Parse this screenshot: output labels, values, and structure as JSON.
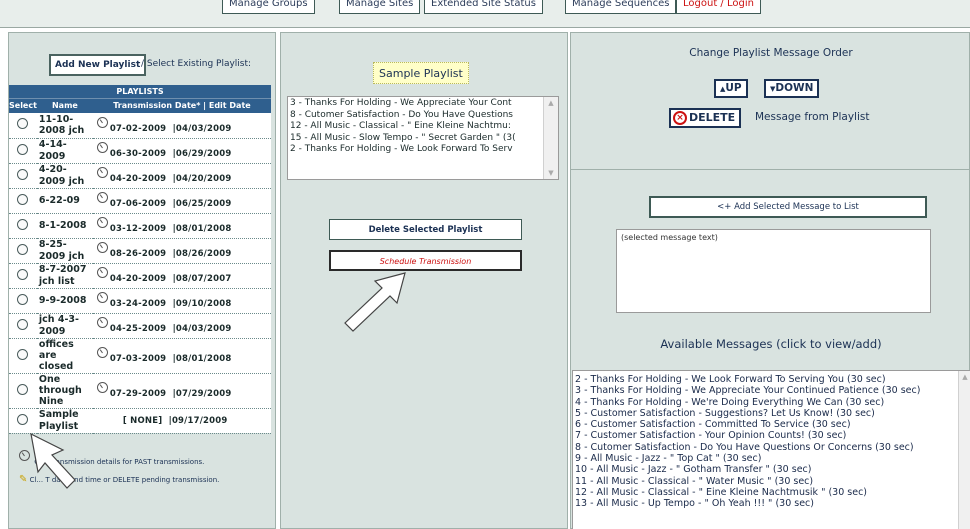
{
  "top_nav": {
    "manage_groups": "Manage Groups",
    "manage_sites": "Manage Sites",
    "extended_site_status": "Extended Site Status",
    "manage_sequences": "Manage Sequences",
    "logout_login": "Logout / Login"
  },
  "left": {
    "add_new_playlist": "Add New Playlist",
    "select_existing": "/ Select Existing Playlist:",
    "table_title": "PLAYLISTS",
    "columns": {
      "select": "Select",
      "name": "Name",
      "dates": "Transmission Date* | Edit Date"
    },
    "rows": [
      {
        "name": "11-10-2008 jch",
        "tx": "07-02-2009",
        "edit": "04/03/2009"
      },
      {
        "name": "4-14-2009",
        "tx": "06-30-2009",
        "edit": "06/29/2009"
      },
      {
        "name": "4-20-2009 jch",
        "tx": "04-20-2009",
        "edit": "04/20/2009"
      },
      {
        "name": "6-22-09",
        "tx": "07-06-2009",
        "edit": "06/25/2009"
      },
      {
        "name": "8-1-2008",
        "tx": "03-12-2009",
        "edit": "08/01/2008"
      },
      {
        "name": "8-25-2009 jch",
        "tx": "08-26-2009",
        "edit": "08/26/2009"
      },
      {
        "name": "8-7-2007 jch list",
        "tx": "04-20-2009",
        "edit": "08/07/2007"
      },
      {
        "name": "9-9-2008",
        "tx": "03-24-2009",
        "edit": "09/10/2008"
      },
      {
        "name": "jch 4-3-2009",
        "tx": "04-25-2009",
        "edit": "04/03/2009"
      },
      {
        "name": "offices are closed",
        "tx": "07-03-2009",
        "edit": "08/01/2008"
      },
      {
        "name": "One through Nine",
        "tx": "07-29-2009",
        "edit": "07/29/2009"
      },
      {
        "name": "Sample Playlist",
        "tx": "[ NONE]",
        "edit": "09/17/2009"
      }
    ],
    "hint_past": "Cl... transmission details for PAST transmissions.",
    "hint_edit": "Cl... T date and time  or DELETE pending transmission."
  },
  "mid": {
    "playlist_title": "Sample Playlist",
    "playlist_items": [
      "3 - Thanks For Holding - We Appreciate Your Cont",
      "8 - Cutomer Satisfaction - Do You Have Questions",
      "12 - All Music - Classical - \" Eine Kleine Nachtmu:",
      "15 - All Music - Slow Tempo - \" Secret Garden \" (3(",
      "2 - Thanks For Holding - We Look Forward To Serv"
    ],
    "delete_selected": "Delete Selected Playlist",
    "schedule": "Schedule Transmission"
  },
  "right": {
    "change_order_title": "Change Playlist Message Order",
    "up": "UP",
    "down": "DOWN",
    "delete": "DELETE",
    "delete_suffix": "Message from Playlist",
    "add_selected": "<+ Add Selected Message to List",
    "selected_text": "(selected message text)",
    "available_title": "Available Messages (click to view/add)",
    "messages": [
      "2 - Thanks For Holding - We Look Forward To Serving You (30 sec)",
      "3 - Thanks For Holding - We Appreciate Your Continued Patience (30 sec)",
      "4 - Thanks For Holding - We're Doing Everything We Can (30 sec)",
      "5 - Customer Satisfaction - Suggestions? Let Us Know! (30 sec)",
      "6 - Customer Satisfaction - Committed To Service (30 sec)",
      "7 - Customer Satisfaction - Your Opinion Counts! (30 sec)",
      "8 - Cutomer Satisfaction - Do You Have Questions Or Concerns (30 sec)",
      "9 - All Music - Jazz - \" Top Cat \" (30 sec)",
      "10 - All Music - Jazz - \" Gotham Transfer \" (30 sec)",
      "11 - All Music - Classical - \" Water Music \" (30 sec)",
      "12 - All Music - Classical - \" Eine Kleine Nachtmusik \" (30 sec)",
      "13 - All Music - Up Tempo - \" Oh Yeah !!! \" (30 sec)"
    ]
  }
}
